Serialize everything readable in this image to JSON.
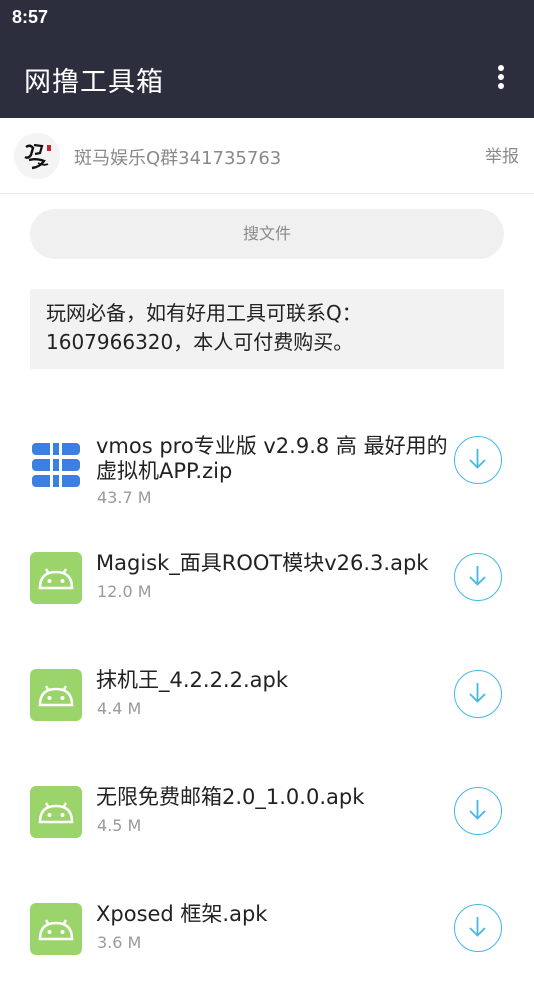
{
  "status_bar": {
    "time": "8:57"
  },
  "app_bar": {
    "title": "网撸工具箱",
    "menu_icon": "more-vertical-icon"
  },
  "sharer": {
    "name": "斑马娱乐Q群341735763",
    "report_label": "举报",
    "avatar_logo_text": "斑马"
  },
  "search": {
    "placeholder": "搜文件"
  },
  "notice": {
    "text": "玩网必备，如有好用工具可联系Q：1607966320，本人可付费购买。"
  },
  "files": [
    {
      "name": "vmos pro专业版 v2.9.8 高 最好用的虚拟机APP.zip",
      "size": "43.7 M",
      "icon": "zip-file-icon"
    },
    {
      "name": "Magisk_面具ROOT模块v26.3.apk",
      "size": "12.0 M",
      "icon": "android-apk-icon"
    },
    {
      "name": "抹机王_4.2.2.2.apk",
      "size": "4.4 M",
      "icon": "android-apk-icon"
    },
    {
      "name": "无限免费邮箱2.0_1.0.0.apk",
      "size": "4.5 M",
      "icon": "android-apk-icon"
    },
    {
      "name": "Xposed 框架.apk",
      "size": "3.6 M",
      "icon": "android-apk-icon"
    }
  ],
  "colors": {
    "header_bg": "#2c2e3d",
    "accent_blue": "#45b8e6",
    "apk_green": "#9bd46a",
    "zip_blue": "#3b7fe4"
  }
}
